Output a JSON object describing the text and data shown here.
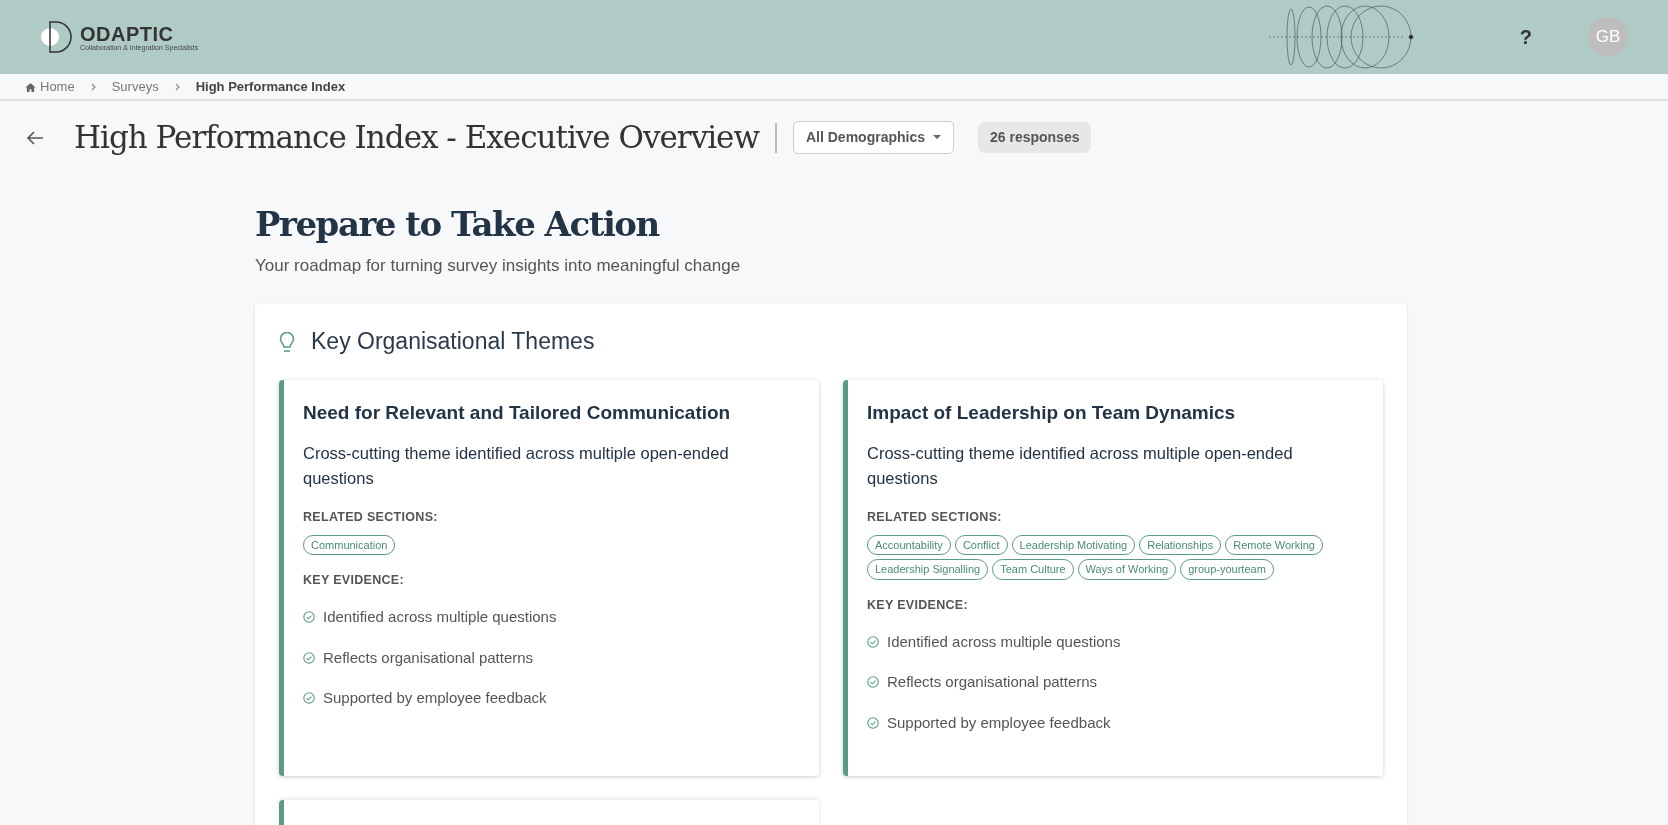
{
  "header": {
    "logo": {
      "name": "ODAPTIC",
      "tagline": "Collaboration & Integration Specialists"
    },
    "help": "?",
    "avatar": "GB"
  },
  "breadcrumbs": [
    {
      "label": "Home",
      "kind": "home",
      "current": false
    },
    {
      "label": "Surveys",
      "kind": "link",
      "current": false
    },
    {
      "label": "High Performance Index",
      "kind": "link",
      "current": true
    }
  ],
  "page_title": "High Performance Index - Executive Overview",
  "filter": {
    "value": "All Demographics"
  },
  "responses": "26 responses",
  "heading": "Prepare to Take Action",
  "subheading": "Your roadmap for turning survey insights into meaningful change",
  "panel": {
    "title": "Key Organisational Themes",
    "themes": [
      {
        "title": "Need for Relevant and Tailored Communication",
        "description": "Cross-cutting theme identified across multiple open-ended questions",
        "related_label": "RELATED SECTIONS:",
        "sections": [
          "Communication"
        ],
        "evidence_label": "KEY EVIDENCE:",
        "evidence": [
          "Identified across multiple questions",
          "Reflects organisational patterns",
          "Supported by employee feedback"
        ]
      },
      {
        "title": "Impact of Leadership on Team Dynamics",
        "description": "Cross-cutting theme identified across multiple open-ended questions",
        "related_label": "RELATED SECTIONS:",
        "sections": [
          "Accountability",
          "Conflict",
          "Leadership Motivating",
          "Relationships",
          "Remote Working",
          "Leadership Signalling",
          "Team Culture",
          "Ways of Working",
          "group-yourteam"
        ],
        "evidence_label": "KEY EVIDENCE:",
        "evidence": [
          "Identified across multiple questions",
          "Reflects organisational patterns",
          "Supported by employee feedback"
        ]
      }
    ],
    "clipped_card": true
  }
}
